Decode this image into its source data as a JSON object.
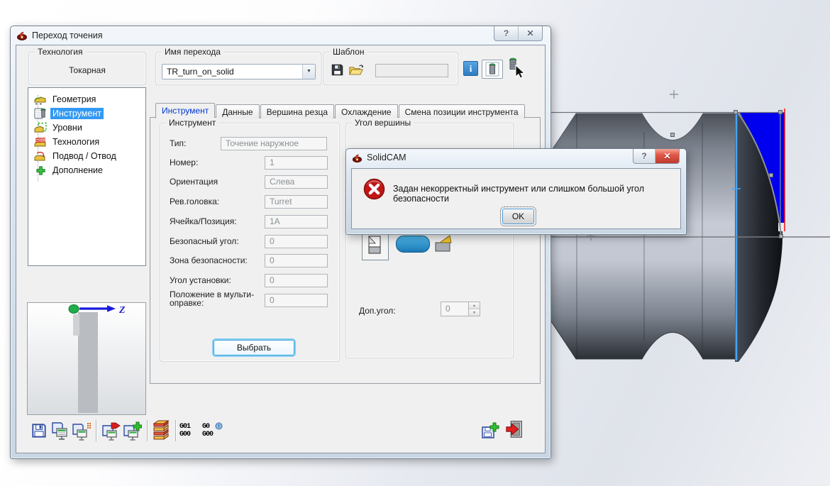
{
  "colors": {
    "selection_blue": "#3399f3",
    "tab_active_text": "#0038d0",
    "error_red": "#c71f1f",
    "stock_highlight_blue": "#0000ee",
    "boundary_cyan": "#45a5f5",
    "boundary_red": "#ff0000"
  },
  "window": {
    "title": "Переход точения"
  },
  "icons": {
    "help_glyph": "?",
    "close_glyph": "✕",
    "info_glyph": "i",
    "combo_arrow": "▼",
    "spin_up": "▲",
    "spin_down": "▼"
  },
  "header": {
    "technology": {
      "label": "Технология",
      "value": "Токарная"
    },
    "operation_name": {
      "label": "Имя перехода",
      "value": "TR_turn_on_solid"
    },
    "template": {
      "label": "Шаблон",
      "field_value": ""
    }
  },
  "sidebar": {
    "items": [
      {
        "label": "Геометрия"
      },
      {
        "label": "Инструмент"
      },
      {
        "label": "Уровни"
      },
      {
        "label": "Технология"
      },
      {
        "label": "Подвод / Отвод"
      },
      {
        "label": "Дополнение"
      }
    ]
  },
  "tabs": {
    "items": [
      "Инструмент",
      "Данные",
      "Вершина резца",
      "Охлаждение",
      "Смена позиции инструмента"
    ]
  },
  "tool_panel": {
    "group_label": "Инструмент",
    "fields": [
      {
        "label": "Тип:",
        "value": "Точение наружное"
      },
      {
        "label": "Номер:",
        "value": "1"
      },
      {
        "label": "Ориентация",
        "value": "Слева"
      },
      {
        "label": "Рев.головка:",
        "value": "Turret"
      },
      {
        "label": "Ячейка/Позиция:",
        "value": "1A"
      },
      {
        "label": "Безопасный угол:",
        "value": "0"
      },
      {
        "label": "Зона безопасности:",
        "value": "0"
      },
      {
        "label": "Угол установки:",
        "value": "0"
      },
      {
        "label": "Положение в мульти-оправке:",
        "value": "0"
      }
    ],
    "select_button": "Выбрать"
  },
  "vertex_panel": {
    "group_label": "Угол вершины",
    "extra_angle_label": "Доп.угол:",
    "extra_angle_value": "0"
  },
  "preview": {
    "axis_label": "Z"
  },
  "toolbar": {
    "gcode_a": "G01\nG00",
    "gcode_b": "G0\nG00"
  },
  "error_dialog": {
    "title": "SolidCAM",
    "message": "Задан некорректный инструмент или слишком большой угол безопасности",
    "ok_label": "OK"
  }
}
